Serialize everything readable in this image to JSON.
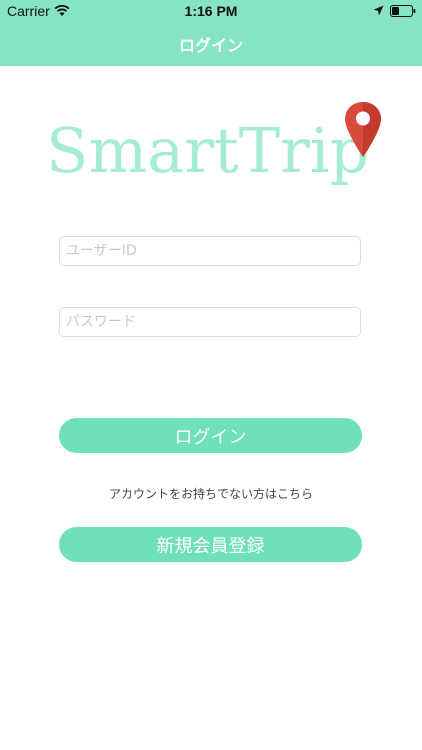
{
  "status_bar": {
    "carrier": "Carrier",
    "time": "1:16 PM"
  },
  "nav": {
    "title": "ログイン"
  },
  "logo": {
    "text": "SmartTrip"
  },
  "form": {
    "user_placeholder": "ユーザーID",
    "password_placeholder": "パスワード",
    "user_value": "",
    "password_value": ""
  },
  "buttons": {
    "login_label": "ログイン",
    "register_label": "新規会員登録"
  },
  "hint_text": "アカウントをお持ちでない方はこちら",
  "colors": {
    "nav_bg": "#86e3c3",
    "button_bg": "#70dfbb",
    "logo_text": "#a6ecd2",
    "pin": "#d94a3a"
  }
}
